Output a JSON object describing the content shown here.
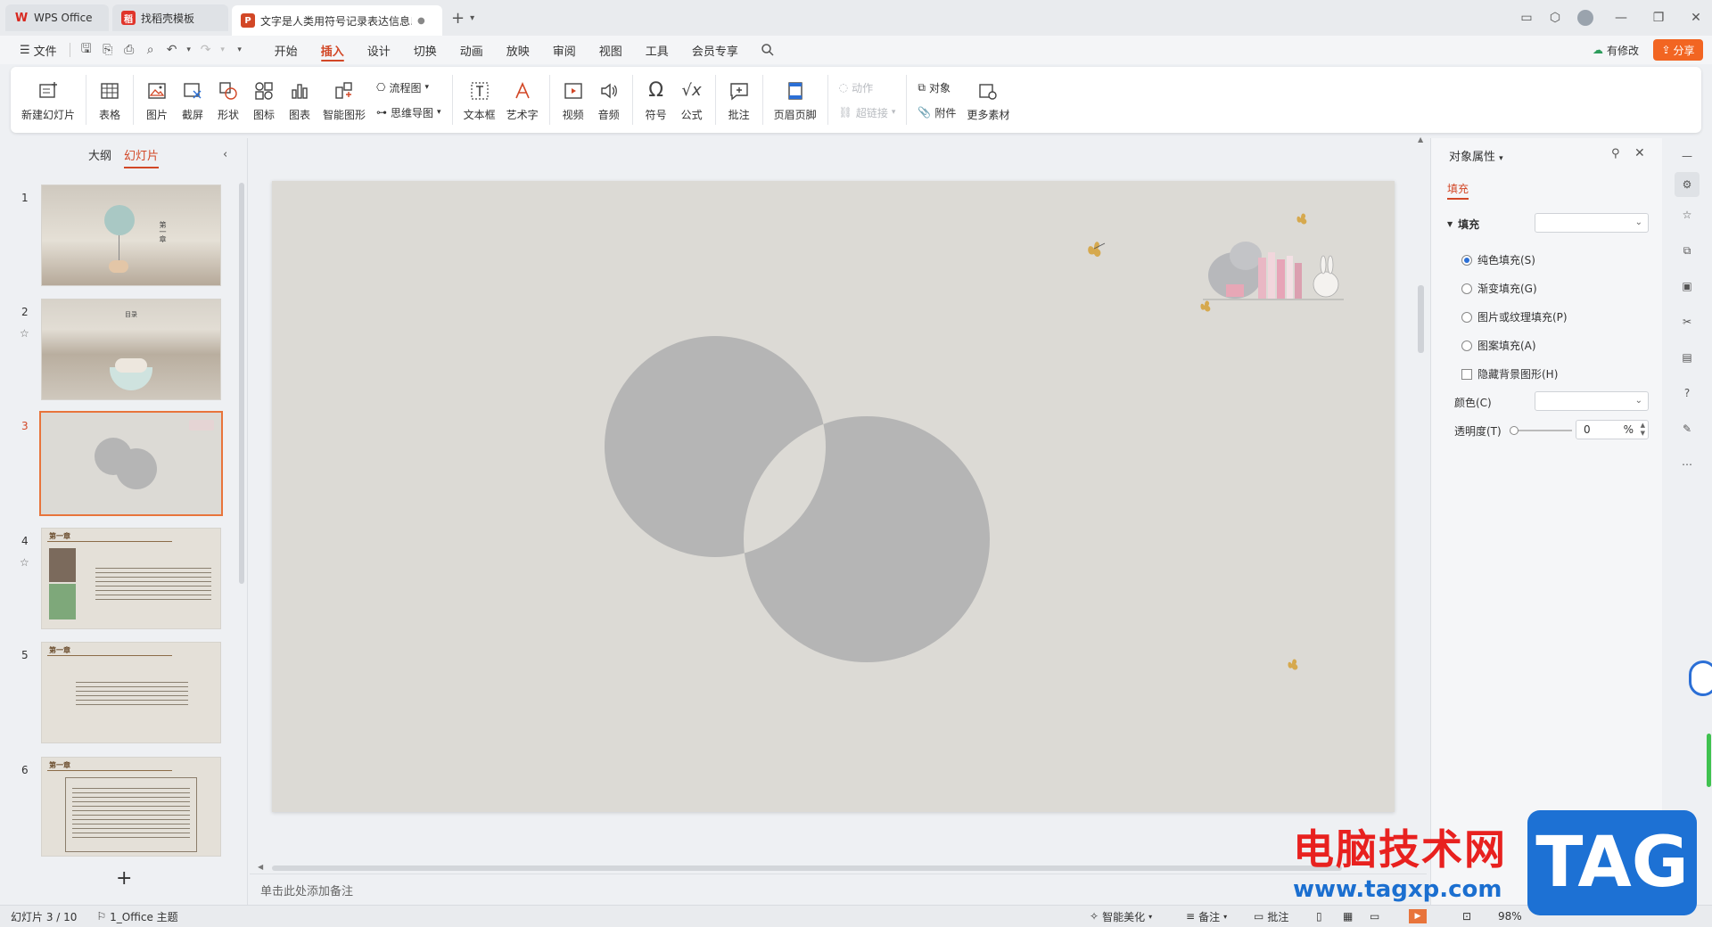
{
  "tabs": [
    {
      "label": "WPS Office"
    },
    {
      "label": "找稻壳模板"
    },
    {
      "label": "文字是人类用符号记录表达信息以"
    }
  ],
  "menu": {
    "file": "文件",
    "items": [
      "开始",
      "插入",
      "设计",
      "切换",
      "动画",
      "放映",
      "审阅",
      "视图",
      "工具",
      "会员专享"
    ],
    "active": "插入",
    "modified": "有修改",
    "share": "分享"
  },
  "ribbon": {
    "new_slide": "新建幻灯片",
    "table": "表格",
    "picture": "图片",
    "screenshot": "截屏",
    "shape": "形状",
    "icon": "图标",
    "chart": "图表",
    "smart_graphic": "智能图形",
    "flowchart": "流程图",
    "mindmap": "思维导图",
    "textbox": "文本框",
    "wordart": "艺术字",
    "video": "视频",
    "audio": "音频",
    "symbol": "符号",
    "formula": "公式",
    "comment": "批注",
    "header_footer": "页眉页脚",
    "action": "动作",
    "hyperlink": "超链接",
    "object": "对象",
    "attachment": "附件",
    "more_material": "更多素材"
  },
  "left_panel": {
    "tab_outline": "大纲",
    "tab_slides": "幻灯片",
    "slides": [
      {
        "number": "1",
        "chapter": "第一章"
      },
      {
        "number": "2",
        "chapter": "目录"
      },
      {
        "number": "3",
        "chapter": ""
      },
      {
        "number": "4",
        "chapter": "第一章"
      },
      {
        "number": "5",
        "chapter": "第一章"
      },
      {
        "number": "6",
        "chapter": "第一章"
      }
    ],
    "selected": "3"
  },
  "notes_placeholder": "单击此处添加备注",
  "right_panel": {
    "title": "对象属性",
    "tab": "填充",
    "fill_section": "填充",
    "options": [
      "纯色填充(S)",
      "渐变填充(G)",
      "图片或纹理填充(P)",
      "图案填充(A)"
    ],
    "selected_option": "纯色填充(S)",
    "hide_bg": "隐藏背景图形(H)",
    "color_label": "颜色(C)",
    "transparency_label": "透明度(T)",
    "transparency_value": "0",
    "percent": "%"
  },
  "status": {
    "slide_counter": "幻灯片 3 / 10",
    "theme": "1_Office 主题",
    "beautify": "智能美化",
    "notes": "备注",
    "comment": "批注",
    "zoom": "98%"
  },
  "watermark": {
    "title": "电脑技术网",
    "url": "www.tagxp.com",
    "tag": "TAG"
  },
  "colors": {
    "accent": "#d24726",
    "slide_bg": "#dcdad5",
    "circle": "#b5b5b5",
    "share_btn": "#f26522"
  }
}
